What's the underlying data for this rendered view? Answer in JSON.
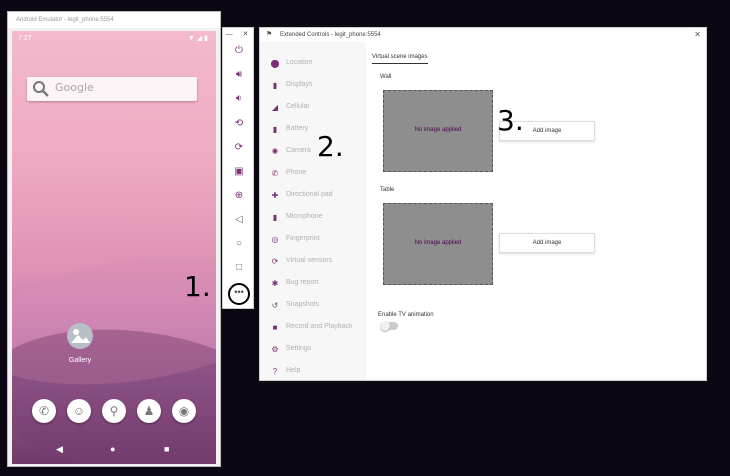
{
  "emulator": {
    "title": "Android Emulator - legit_phone:5554",
    "status_time": "7:27",
    "status_icons": "▼◢▮",
    "search_placeholder": "Google",
    "gallery_label": "Gallery"
  },
  "toolbar": {
    "window_controls": "— ✕",
    "more_label": "•••"
  },
  "extended_controls": {
    "title": "Extended Controls - legit_phone:5554",
    "close": "✕",
    "sidebar": [
      {
        "label": "Location",
        "icon": "map-pin-icon"
      },
      {
        "label": "Displays",
        "icon": "display-icon"
      },
      {
        "label": "Cellular",
        "icon": "signal-icon"
      },
      {
        "label": "Battery",
        "icon": "battery-icon"
      },
      {
        "label": "Camera",
        "icon": "camera-icon"
      },
      {
        "label": "Phone",
        "icon": "phone-icon"
      },
      {
        "label": "Directional pad",
        "icon": "dpad-icon"
      },
      {
        "label": "Microphone",
        "icon": "microphone-icon"
      },
      {
        "label": "Fingerprint",
        "icon": "fingerprint-icon"
      },
      {
        "label": "Virtual sensors",
        "icon": "sensors-icon"
      },
      {
        "label": "Bug report",
        "icon": "bug-icon"
      },
      {
        "label": "Snapshots",
        "icon": "history-icon"
      },
      {
        "label": "Record and Playback",
        "icon": "video-icon"
      },
      {
        "label": "Settings",
        "icon": "gear-icon"
      },
      {
        "label": "Help",
        "icon": "help-icon"
      }
    ],
    "tab": "Virtual scene images",
    "wall": {
      "label": "Wall",
      "placeholder": "No image applied",
      "button": "Add image"
    },
    "table": {
      "label": "Table",
      "placeholder": "No image applied",
      "button": "Add image"
    },
    "tv_animation_label": "Enable TV animation"
  },
  "annotations": {
    "one": "1.",
    "two": "2.",
    "three": "3."
  },
  "colors": {
    "accent": "#7a2f77",
    "image_placeholder": "#8e8e8e"
  }
}
